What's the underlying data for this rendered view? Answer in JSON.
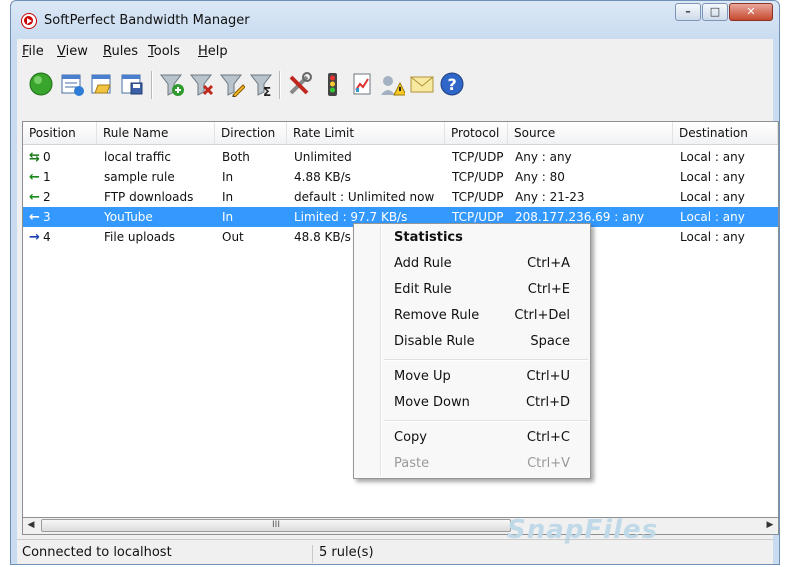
{
  "window": {
    "title": "SoftPerfect Bandwidth Manager"
  },
  "menu": [
    {
      "label": "File",
      "u": "F",
      "rest": "ile"
    },
    {
      "label": "View",
      "u": "V",
      "rest": "iew"
    },
    {
      "label": "Rules",
      "u": "R",
      "rest": "ules"
    },
    {
      "label": "Tools",
      "u": "T",
      "rest": "ools"
    },
    {
      "label": "Help",
      "u": "H",
      "rest": "elp"
    }
  ],
  "toolbar": {
    "icons": [
      "start-icon",
      "rules-list-icon",
      "open-icon",
      "save-icon",
      "add-filter-icon",
      "remove-filter-icon",
      "edit-filter-icon",
      "statistics-filter-icon",
      "settings-tools-icon",
      "traffic-light-icon",
      "report-icon",
      "user-alert-icon",
      "mail-icon",
      "help-icon"
    ]
  },
  "table": {
    "columns": [
      "Position",
      "Rule Name",
      "Direction",
      "Rate Limit",
      "Protocol",
      "Source",
      "Destination"
    ],
    "rows": [
      {
        "arrow": "both",
        "position": "0",
        "name": "local traffic",
        "direction": "Both",
        "rate": "Unlimited",
        "protocol": "TCP/UDP",
        "source": "Any : any",
        "destination": "Local : any"
      },
      {
        "arrow": "in",
        "position": "1",
        "name": "sample rule",
        "direction": "In",
        "rate": "4.88 KB/s",
        "protocol": "TCP/UDP",
        "source": "Any : 80",
        "destination": "Local : any"
      },
      {
        "arrow": "in",
        "position": "2",
        "name": "FTP downloads",
        "direction": "In",
        "rate": "default : Unlimited now",
        "protocol": "TCP/UDP",
        "source": "Any : 21-23",
        "destination": "Local : any"
      },
      {
        "arrow": "in",
        "position": "3",
        "name": "YouTube",
        "direction": "In",
        "rate": "Limited : 97.7 KB/s",
        "protocol": "TCP/UDP",
        "source": "208.177.236.69 : any",
        "destination": "Local : any",
        "selected": true
      },
      {
        "arrow": "out",
        "position": "4",
        "name": "File uploads",
        "direction": "Out",
        "rate": "48.8 KB/s",
        "protocol": "",
        "source": "",
        "destination": "Local : any"
      }
    ]
  },
  "context_menu": {
    "items": [
      {
        "label": "Statistics",
        "shortcut": "",
        "style": "bold"
      },
      {
        "label": "Add Rule",
        "shortcut": "Ctrl+A"
      },
      {
        "label": "Edit Rule",
        "shortcut": "Ctrl+E"
      },
      {
        "label": "Remove Rule",
        "shortcut": "Ctrl+Del"
      },
      {
        "label": "Disable Rule",
        "shortcut": "Space"
      },
      {
        "label": "Move Up",
        "shortcut": "Ctrl+U"
      },
      {
        "label": "Move Down",
        "shortcut": "Ctrl+D"
      },
      {
        "label": "Copy",
        "shortcut": "Ctrl+C"
      },
      {
        "label": "Paste",
        "shortcut": "Ctrl+V",
        "style": "disabled"
      }
    ]
  },
  "scrollbar": {
    "thumb_grip": "III"
  },
  "status": {
    "connection": "Connected to localhost",
    "rule_count": "5 rule(s)"
  },
  "watermark": "SnapFiles",
  "colors": {
    "selection": "#3399ff",
    "arrow_in": "#1a8a1a",
    "arrow_out": "#1a3fb0"
  }
}
